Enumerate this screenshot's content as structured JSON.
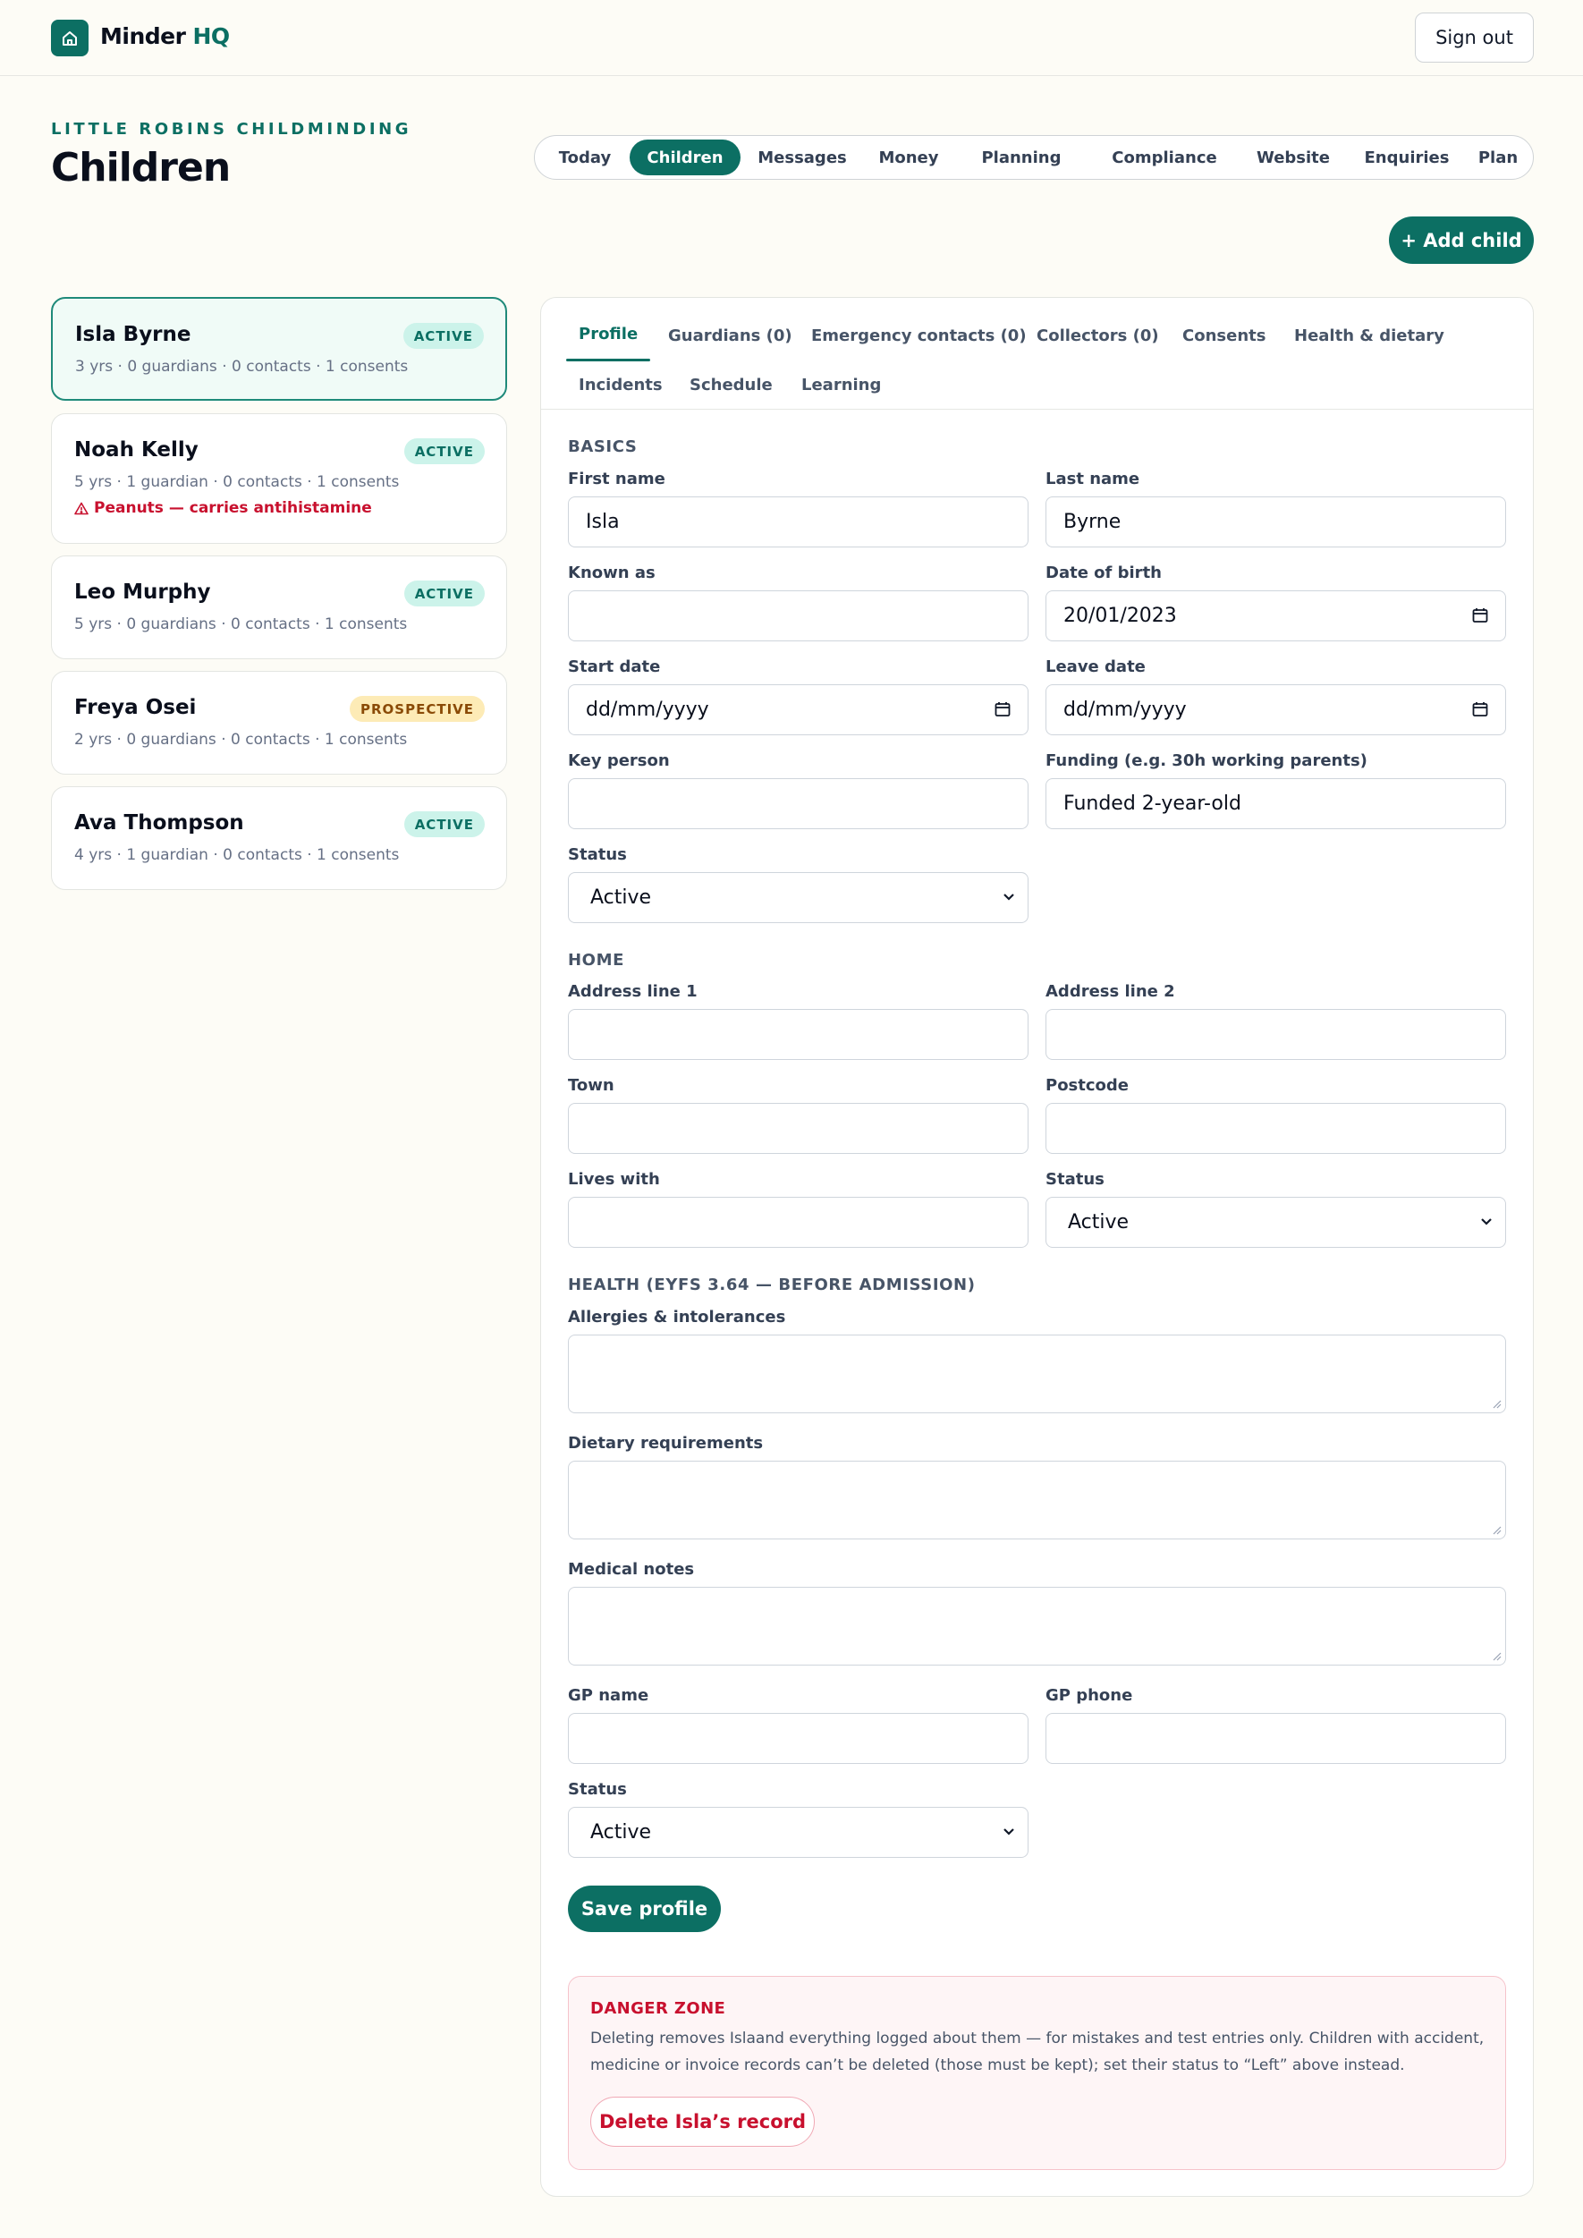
{
  "app": {
    "name": "Minder",
    "suffix": "HQ",
    "sign_out": "Sign out"
  },
  "header": {
    "org": "LITTLE ROBINS CHILDMINDING",
    "title": "Children"
  },
  "nav": [
    "Today",
    "Children",
    "Messages",
    "Money",
    "Planning",
    "Compliance",
    "Website",
    "Enquiries",
    "Plan"
  ],
  "nav_active": "Children",
  "add_child": "+ Add child",
  "children": [
    {
      "name": "Isla Byrne",
      "status": "ACTIVE",
      "meta": "3 yrs · 0 guardians · 0 contacts · 1 consents",
      "selected": true
    },
    {
      "name": "Noah Kelly",
      "status": "ACTIVE",
      "meta": "5 yrs · 1 guardian · 0 contacts · 1 consents",
      "alert": "Peanuts — carries antihistamine"
    },
    {
      "name": "Leo Murphy",
      "status": "ACTIVE",
      "meta": "5 yrs · 0 guardians · 0 contacts · 1 consents"
    },
    {
      "name": "Freya Osei",
      "status": "PROSPECTIVE",
      "meta": "2 yrs · 0 guardians · 0 contacts · 1 consents"
    },
    {
      "name": "Ava Thompson",
      "status": "ACTIVE",
      "meta": "4 yrs · 1 guardian · 0 contacts · 1 consents"
    }
  ],
  "tabs": [
    "Profile",
    "Guardians (0)",
    "Emergency contacts (0)",
    "Collectors (0)",
    "Consents",
    "Health & dietary",
    "Incidents",
    "Schedule",
    "Learning"
  ],
  "form": {
    "basics": {
      "title": "BASICS",
      "first_name": {
        "label": "First name",
        "value": "Isla"
      },
      "last_name": {
        "label": "Last name",
        "value": "Byrne"
      },
      "known_as": {
        "label": "Known as",
        "value": ""
      },
      "dob": {
        "label": "Date of birth",
        "value": "20/01/2023"
      },
      "start_date": {
        "label": "Start date",
        "value": "dd/mm/yyyy"
      },
      "leave_date": {
        "label": "Leave date",
        "value": "dd/mm/yyyy"
      },
      "key_person": {
        "label": "Key person",
        "value": ""
      },
      "funding": {
        "label": "Funding (e.g. 30h working parents)",
        "value": "Funded 2-year-old"
      },
      "status": {
        "label": "Status",
        "value": "Active"
      }
    },
    "home": {
      "title": "HOME",
      "address1": {
        "label": "Address line 1",
        "value": ""
      },
      "address2": {
        "label": "Address line 2",
        "value": ""
      },
      "town": {
        "label": "Town",
        "value": ""
      },
      "postcode": {
        "label": "Postcode",
        "value": ""
      },
      "lives_with": {
        "label": "Lives with",
        "value": ""
      },
      "status": {
        "label": "Status",
        "value": "Active"
      }
    },
    "health": {
      "title": "HEALTH (EYFS 3.64 — BEFORE ADMISSION)",
      "allergies": {
        "label": "Allergies & intolerances",
        "value": ""
      },
      "dietary": {
        "label": "Dietary requirements",
        "value": ""
      },
      "medical": {
        "label": "Medical notes",
        "value": ""
      },
      "gp_name": {
        "label": "GP name",
        "value": ""
      },
      "gp_phone": {
        "label": "GP phone",
        "value": ""
      },
      "status": {
        "label": "Status",
        "value": "Active"
      }
    },
    "save": "Save profile"
  },
  "danger": {
    "title": "DANGER ZONE",
    "text": "Deleting removes Islaand everything logged about them — for mistakes and test entries only. Children with accident, medicine or invoice records can’t be deleted (those must be kept); set their status to “Left” above instead.",
    "button": "Delete Isla’s record"
  },
  "colors": {
    "brand": "#0c6f63",
    "danger": "#c8102e",
    "background": "#fdfcf6"
  }
}
